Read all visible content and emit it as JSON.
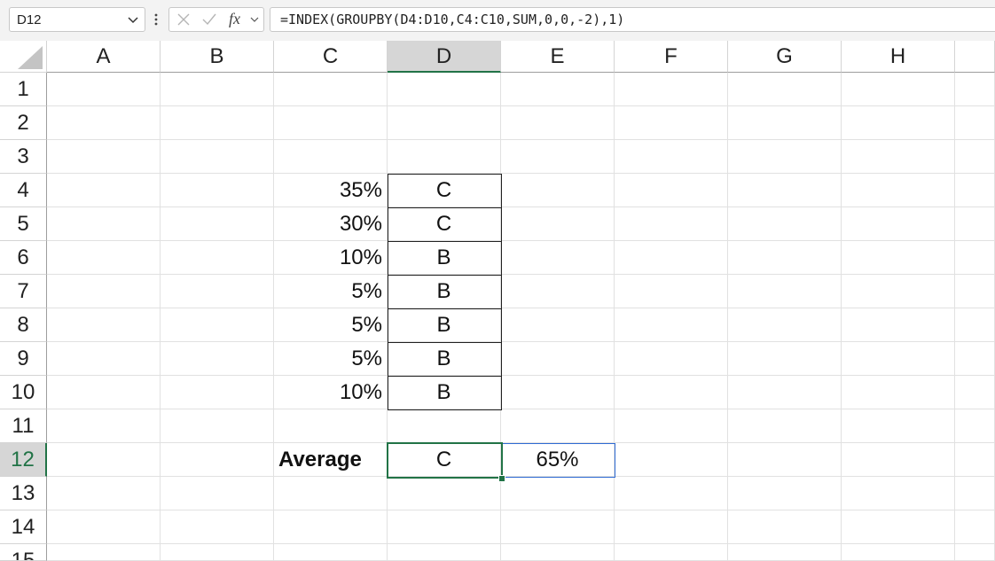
{
  "name_box": {
    "value": "D12"
  },
  "formula_bar": {
    "formula": "=INDEX(GROUPBY(D4:D10,C4:C10,SUM,0,0,-2),1)"
  },
  "columns": [
    "A",
    "B",
    "C",
    "D",
    "E",
    "F",
    "G",
    "H"
  ],
  "rows": [
    "1",
    "2",
    "3",
    "4",
    "5",
    "6",
    "7",
    "8",
    "9",
    "10",
    "11",
    "12",
    "13",
    "14",
    "15"
  ],
  "cells": {
    "C4": "35%",
    "D4": "C",
    "C5": "30%",
    "D5": "C",
    "C6": "10%",
    "D6": "B",
    "C7": "5%",
    "D7": "B",
    "C8": "5%",
    "D8": "B",
    "C9": "5%",
    "D9": "B",
    "C10": "10%",
    "D10": "B",
    "C12": "Average",
    "D12": "C",
    "E12": "65%"
  },
  "colors": {
    "accent_green": "#217346",
    "spill_blue": "#2f6bd4",
    "header_selected": "#d6d6d6"
  },
  "icons": [
    "chevron-down-icon",
    "more-options-icon",
    "cancel-icon",
    "enter-icon",
    "fx-icon"
  ]
}
